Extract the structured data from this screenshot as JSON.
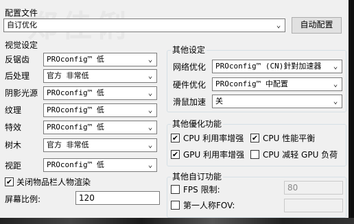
{
  "window": {
    "title": "配置文件"
  },
  "profile": {
    "selected": "自订优化",
    "auto_button": "自动配置"
  },
  "visual": {
    "title": "视觉设定",
    "rows": [
      {
        "label": "反锯齿",
        "value": "PROconfig™ 低"
      },
      {
        "label": "后处理",
        "value": "官方 非常低"
      },
      {
        "label": "阴影光源",
        "value": "PROconfig™ 低"
      },
      {
        "label": "纹理",
        "value": "PROconfig™ 低"
      },
      {
        "label": "特效",
        "value": "PROconfig™ 低"
      },
      {
        "label": "树木",
        "value": "官方 非常低"
      },
      {
        "label": "视距",
        "value": "PROconfig™ 低"
      }
    ],
    "disable_items_label": "关闭物品栏人物渲染",
    "disable_items_checked": true,
    "screen_ratio_label": "屏幕比例:",
    "screen_ratio_value": "120"
  },
  "other": {
    "title": "其他设定",
    "rows": [
      {
        "label": "网络优化",
        "value": "PROconfig™ (CN)針對加速器"
      },
      {
        "label": "硬件优化",
        "value": "PROconfig™ 中配置"
      },
      {
        "label": "滑鼠加速",
        "value": "关"
      }
    ]
  },
  "optimize": {
    "title": "其他優化功能",
    "items": [
      {
        "label": "CPU 利用率增强",
        "checked": true
      },
      {
        "label": "CPU 性能平衡",
        "checked": true
      },
      {
        "label": "GPU 利用率增强",
        "checked": true
      },
      {
        "label": "CPU 减轻 GPU 负荷",
        "checked": false
      }
    ]
  },
  "custom": {
    "title": "其他自订功能",
    "fps_label": "FPS 限制:",
    "fps_value": "80",
    "fov_label": "第一人称FOV:",
    "fov_value": ""
  },
  "icons": {
    "check": "✔",
    "dropdown": "⌄"
  }
}
